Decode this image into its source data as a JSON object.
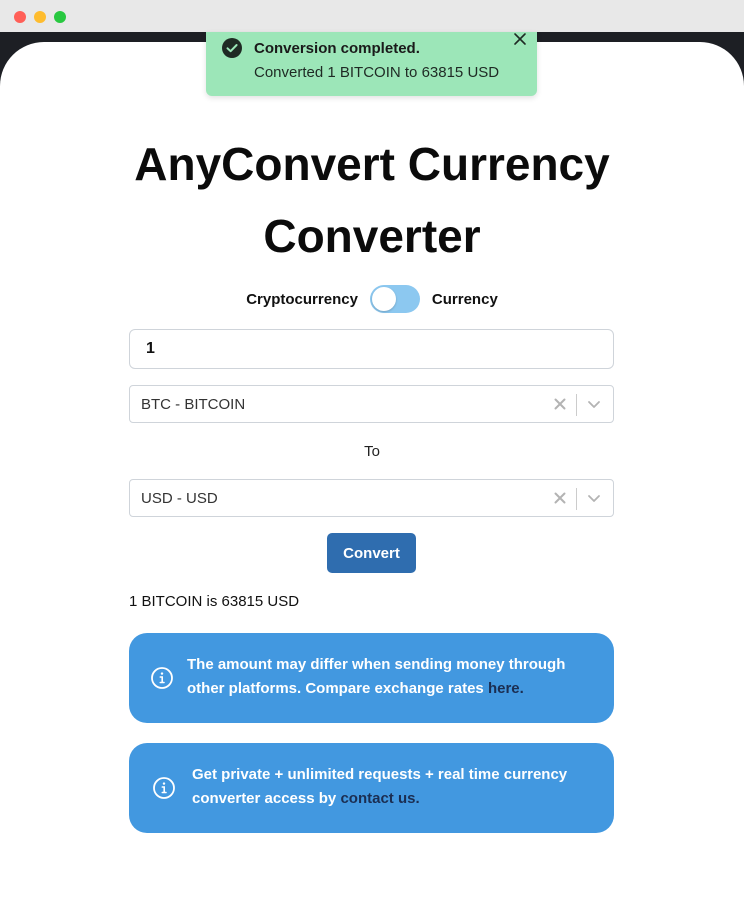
{
  "toast": {
    "title": "Conversion completed.",
    "message": "Converted 1 BITCOIN to 63815 USD"
  },
  "heading": {
    "line1": "AnyConvert Currency",
    "line2": "Converter"
  },
  "toggle": {
    "left_label": "Cryptocurrency",
    "right_label": "Currency"
  },
  "form": {
    "amount_value": "1",
    "from_value": "BTC - BITCOIN",
    "to_label": "To",
    "to_value": "USD - USD",
    "convert_label": "Convert"
  },
  "result_text": "1 BITCOIN is 63815 USD",
  "info_cards": [
    {
      "text": "The amount may differ when sending money through other platforms. Compare exchange rates ",
      "link": "here."
    },
    {
      "text": "Get private + unlimited requests + real time currency converter access by ",
      "link": "contact us."
    }
  ],
  "colors": {
    "toast_bg": "#9ce6b8",
    "accent": "#2f6daf",
    "info_bg": "#4298e0",
    "switch": "#8cc8f0"
  },
  "icons": {
    "toast": "check-circle-icon",
    "toast_close": "close-icon",
    "clear": "clear-x-icon",
    "dropdown": "chevron-down-icon",
    "info": "info-circle-icon"
  }
}
